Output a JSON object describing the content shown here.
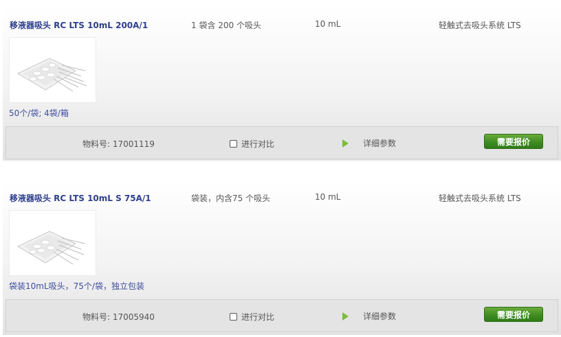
{
  "products": [
    {
      "name": "移液器吸头 RC LTS 10mL 200A/1",
      "packaging": "1 袋含 200 个吸头",
      "volume": "10 mL",
      "system": "轻触式去吸头系统 LTS",
      "description": "50个/袋; 4袋/箱",
      "part_number": "物料号: 17001119",
      "compare_label": "进行对比",
      "details_label": "详细参数",
      "quote_label": "需要报价"
    },
    {
      "name": "移液器吸头 RC LTS 10mL S 75A/1",
      "packaging": "袋装，内含75 个吸头",
      "volume": "10 mL",
      "system": "轻触式去吸头系统 LTS",
      "description": "袋装10mL吸头，75个/袋，独立包装",
      "part_number": "物料号: 17005940",
      "compare_label": "进行对比",
      "details_label": "详细参数",
      "quote_label": "需要报价"
    }
  ],
  "icons": {
    "play": "play-icon",
    "checkbox": "checkbox-unchecked"
  },
  "colors": {
    "title": "#2d3f8c",
    "quote_button": "#3f8c22",
    "play_icon": "#7dbd3a"
  }
}
